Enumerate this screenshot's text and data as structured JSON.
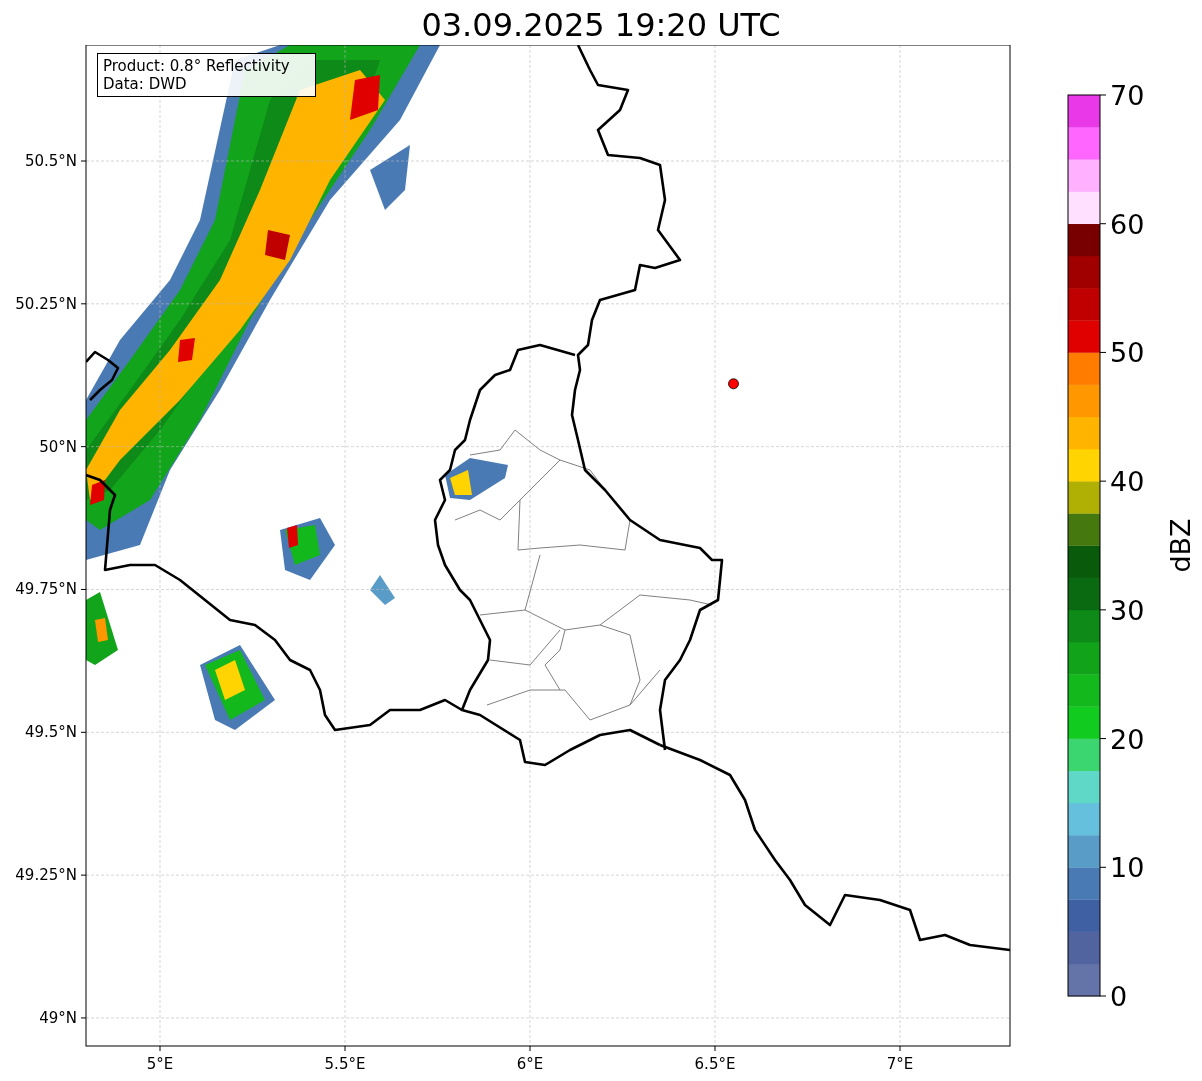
{
  "title": "03.09.2025 19:20 UTC",
  "info_box": {
    "lines": [
      "Product: 0.8° Reflectivity",
      "Data: DWD"
    ]
  },
  "map": {
    "lat_labels": [
      "50.5°N",
      "50.25°N",
      "50°N",
      "49.75°N",
      "49.5°N",
      "49.25°N",
      "49°N"
    ],
    "lon_labels": [
      "5°E",
      "5.5°E",
      "6°E",
      "6.5°E",
      "7°E"
    ]
  },
  "colorbar": {
    "label": "dBZ",
    "ticks": [
      "70",
      "60",
      "50",
      "40",
      "30",
      "20",
      "10",
      "0"
    ],
    "bins": [
      {
        "color": "#6474a8"
      },
      {
        "color": "#5264a0"
      },
      {
        "color": "#4060a4"
      },
      {
        "color": "#4a7ab4"
      },
      {
        "color": "#5a9cc8"
      },
      {
        "color": "#64c0dc"
      },
      {
        "color": "#60d8c8"
      },
      {
        "color": "#3cd670"
      },
      {
        "color": "#11cc1f"
      },
      {
        "color": "#12b81c"
      },
      {
        "color": "#11a41a"
      },
      {
        "color": "#0d8a17"
      },
      {
        "color": "#0a6a12"
      },
      {
        "color": "#0a5a0c"
      },
      {
        "color": "#467810"
      },
      {
        "color": "#b0b004"
      },
      {
        "color": "#ffd400"
      },
      {
        "color": "#ffb400"
      },
      {
        "color": "#ff9800"
      },
      {
        "color": "#ff7c00"
      },
      {
        "color": "#e00000"
      },
      {
        "color": "#c00000"
      },
      {
        "color": "#a00000"
      },
      {
        "color": "#780000"
      },
      {
        "color": "#ffe0ff"
      },
      {
        "color": "#ffb0ff"
      },
      {
        "color": "#ff66ff"
      },
      {
        "color": "#e838e8"
      }
    ]
  }
}
